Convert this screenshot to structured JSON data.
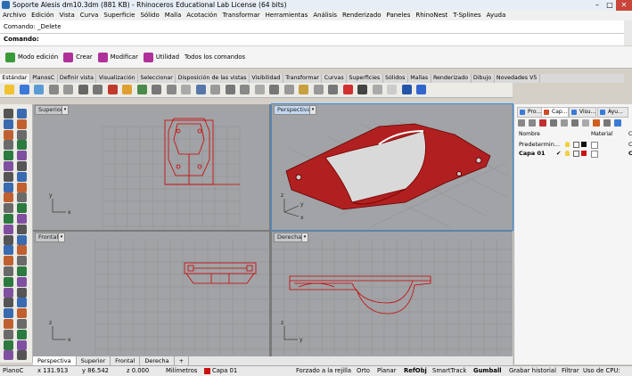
{
  "window": {
    "title": "Soporte Alesis dm10.3dm (881 KB) - Rhinoceros Educational Lab License (64 bits)"
  },
  "menu": [
    "Archivo",
    "Edición",
    "Vista",
    "Curva",
    "Superficie",
    "Sólido",
    "Malla",
    "Acotación",
    "Transformar",
    "Herramientas",
    "Análisis",
    "Renderizado",
    "Paneles",
    "RhinoNest",
    "T-Splines",
    "Ayuda"
  ],
  "command": {
    "history": "Comando: _Delete",
    "prompt": "Comando:"
  },
  "ribbon": [
    {
      "label": "Modo edición",
      "icon": "power-icon",
      "color": "#3a9a3a"
    },
    {
      "label": "Crear",
      "icon": "create-icon",
      "color": "#b0309a"
    },
    {
      "label": "Modificar",
      "icon": "modify-icon",
      "color": "#b0309a"
    },
    {
      "label": "Utilidad",
      "icon": "utility-icon",
      "color": "#b0309a"
    },
    {
      "label": "Todos los comandos",
      "icon": "",
      "color": ""
    }
  ],
  "toolbar_tabs": [
    "Estándar",
    "PlanosC",
    "Definir vista",
    "Visualización",
    "Seleccionar",
    "Disposición de las vistas",
    "Visibilidad",
    "Transformar",
    "Curvas",
    "Superficies",
    "Sólidos",
    "Mallas",
    "Renderizado",
    "Dibujo",
    "Novedades V5"
  ],
  "viewports": [
    {
      "label": "Superior",
      "axes": [
        "y",
        "x"
      ]
    },
    {
      "label": "Perspectiva",
      "axes": [
        "z",
        "y",
        "x"
      ]
    },
    {
      "label": "Frontal",
      "axes": [
        "z",
        "x"
      ]
    },
    {
      "label": "Derecha",
      "axes": [
        "z",
        "y"
      ]
    }
  ],
  "viewport_tabs": [
    "Perspectiva",
    "Superior",
    "Frontal",
    "Derecha",
    "+"
  ],
  "panel": {
    "tabs": [
      {
        "label": "Pro...",
        "icon": "properties-icon",
        "color": "#3a7bd5"
      },
      {
        "label": "Cap...",
        "icon": "layers-icon",
        "color": "#d04a2a"
      },
      {
        "label": "Visu...",
        "icon": "display-icon",
        "color": "#3a7bd5"
      },
      {
        "label": "Ayu...",
        "icon": "help-icon",
        "color": "#3a7bd5"
      }
    ],
    "columns": {
      "name": "Nombre",
      "material": "Material",
      "extra": "C"
    },
    "layers": [
      {
        "name": "Predetermin...",
        "current": "",
        "color": "#111111",
        "extra": "C"
      },
      {
        "name": "Capa 01",
        "current": "✔",
        "color": "#cc1111",
        "extra": "C"
      }
    ]
  },
  "status": {
    "cplane": "PlanoC",
    "x": "x 131.913",
    "y": "y 86.542",
    "z": "z 0.000",
    "units": "Milímetros",
    "layer": "Capa 01",
    "layer_color": "#cc1111",
    "toggles": [
      "Forzado a la rejilla",
      "Orto",
      "Planar",
      "RefObj",
      "SmartTrack",
      "Gumball",
      "Grabar historial",
      "Filtrar",
      "Uso de CPU:"
    ]
  },
  "colors": {
    "accent": "#3b8de0",
    "model_line": "#cc0000",
    "viewport_bg": "#a1a3a6"
  }
}
